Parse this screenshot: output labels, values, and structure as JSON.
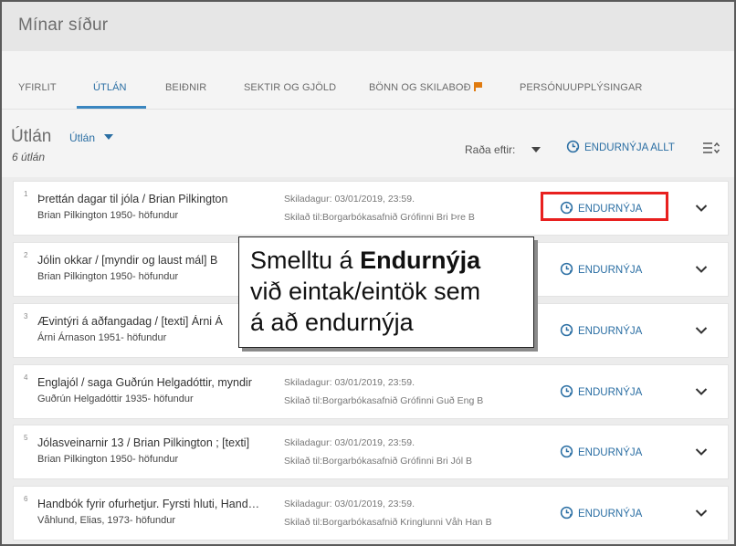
{
  "page": {
    "title": "Mínar síður"
  },
  "tabs": [
    {
      "label": "YFIRLIT",
      "active": false
    },
    {
      "label": "ÚTLÁN",
      "active": true
    },
    {
      "label": "BEIÐNIR",
      "active": false
    },
    {
      "label": "SEKTIR OG GJÖLD",
      "active": false
    },
    {
      "label": "BÖNN OG SKILABOÐ",
      "active": false,
      "icon": "flag-icon"
    },
    {
      "label": "PERSÓNUUPPLÝSINGAR",
      "active": false
    }
  ],
  "section": {
    "title": "Útlán",
    "filter_value": "Útlán",
    "count": "6 útlán",
    "sort_label": "Raða eftir:",
    "renew_all_label": "ENDURNÝJA ALLT"
  },
  "loans": [
    {
      "num": "1",
      "title": "Þrettán dagar til jóla / Brian Pilkington",
      "author": "Brian Pilkington 1950- höfundur",
      "due": "Skiladagur: 03/01/2019, 23:59.",
      "return_to": "Skilað til:Borgarbókasafnið Grófinni Bri Þre B",
      "renew_label": "ENDURNÝJA",
      "highlighted": true
    },
    {
      "num": "2",
      "title": "Jólin okkar / [myndir og laust mál] B",
      "author": "Brian Pilkington 1950- höfundur",
      "due": "",
      "return_to": "",
      "renew_label": "ENDURNÝJA",
      "highlighted": false
    },
    {
      "num": "3",
      "title": "Ævintýri á aðfangadag / [texti] Árni Á",
      "author": "Árni Árnason 1951- höfundur",
      "due": "",
      "return_to": "",
      "renew_label": "ENDURNÝJA",
      "highlighted": false
    },
    {
      "num": "4",
      "title": "Englajól / saga Guðrún Helgadóttir, myndir",
      "author": "Guðrún Helgadóttir 1935- höfundur",
      "due": "Skiladagur: 03/01/2019, 23:59.",
      "return_to": "Skilað til:Borgarbókasafnið Grófinni Guð Eng B",
      "renew_label": "ENDURNÝJA",
      "highlighted": false
    },
    {
      "num": "5",
      "title": "Jólasveinarnir 13 / Brian Pilkington ; [texti]",
      "author": "Brian Pilkington 1950- höfundur",
      "due": "Skiladagur: 03/01/2019, 23:59.",
      "return_to": "Skilað til:Borgarbókasafnið Grófinni Bri Jól B",
      "renew_label": "ENDURNÝJA",
      "highlighted": false
    },
    {
      "num": "6",
      "title": "Handbók fyrir ofurhetjur. Fyrsti hluti, Handbókin",
      "author": "Våhlund, Elias, 1973- höfundur",
      "due": "Skiladagur: 03/01/2019, 23:59.",
      "return_to": "Skilað til:Borgarbókasafnið Kringlunni Våh Han B",
      "renew_label": "ENDURNÝJA",
      "highlighted": false
    }
  ],
  "callout": {
    "line1_prefix": "Smelltu á ",
    "line1_bold": "Endurnýja",
    "line2": "við eintak/eintök sem",
    "line3": "á að endurnýja"
  },
  "colors": {
    "accent": "#2a6ea3",
    "highlight": "#e8201f",
    "flag": "#e07b10"
  }
}
